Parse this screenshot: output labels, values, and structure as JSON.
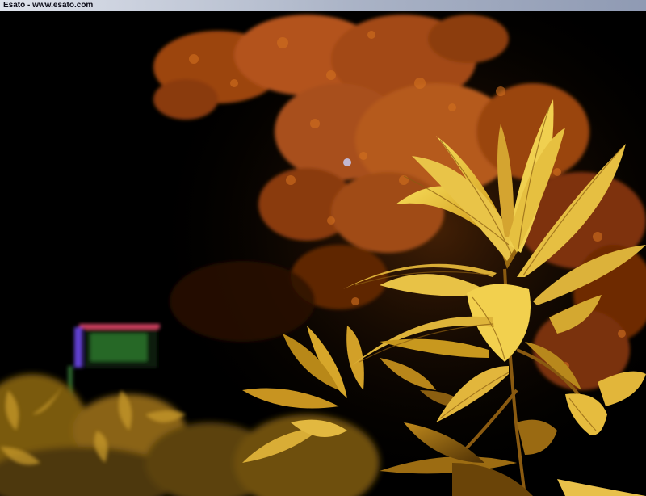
{
  "window": {
    "title": "Esato - www.esato.com"
  },
  "photo": {
    "subject": "night-plant-leaves-photo",
    "colors": {
      "background": "#000000",
      "leaf_light": "#f2d04a",
      "leaf_mid": "#c9951c",
      "leaf_dark": "#6a4206",
      "foliage_orange": "#b5500e",
      "foliage_dark": "#5a2308"
    }
  }
}
